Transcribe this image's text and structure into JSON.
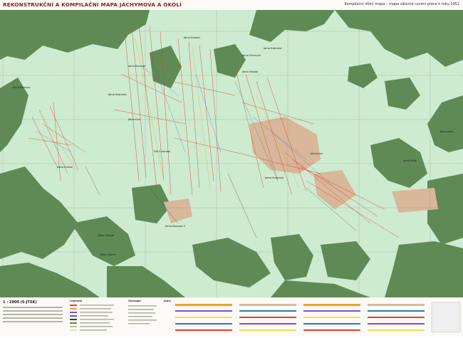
{
  "map_title": "REKONSTRUKČNÍ A KOMPILAČNÍ MAPA JÁCHYMOVA A OKOLÍ",
  "map_subtitle": "Kompilační důlní mapa – mapa zátorné rucení práce k roku 1952",
  "scale_label": "1 : 2000 (S-JTSK)",
  "legend_headings": [
    "Legenda",
    "Geologie",
    "Jámy"
  ],
  "colors": {
    "forest": "#5f8a55",
    "open_land": "#ccebcf",
    "urban": "#d8b79a",
    "mine_lines": "#e63b2e",
    "title_red": "#8c1c1c"
  },
  "labels": [
    {
      "text": "Jáma Eduard"
    },
    {
      "text": "Jáma Rovnost"
    },
    {
      "text": "Jáma Barbora"
    },
    {
      "text": "Jáma Bratrství"
    },
    {
      "text": "Jáma Svornost"
    },
    {
      "text": "Jáma Nikolaj"
    },
    {
      "text": "Jáma Bratrství"
    },
    {
      "text": "Jáma Eva"
    },
    {
      "text": "Důl Svornost"
    },
    {
      "text": "Jáma Evička"
    },
    {
      "text": "Jáchymov"
    },
    {
      "text": "Jáma Svornost"
    },
    {
      "text": "Jáma Josef"
    },
    {
      "text": "Jáma Rovnost II"
    },
    {
      "text": "Tábor Nikolaj"
    },
    {
      "text": "Tábor Ostrov"
    },
    {
      "text": "Jáma Eliáš"
    }
  ]
}
